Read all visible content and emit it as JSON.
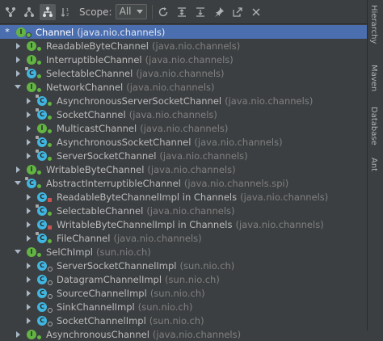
{
  "toolbar": {
    "scope_label": "Scope:",
    "scope_value": "All",
    "buttons": [
      {
        "name": "subtypes-hierarchy-icon"
      },
      {
        "name": "supertypes-hierarchy-icon"
      },
      {
        "name": "type-hierarchy-icon"
      },
      {
        "name": "sort-alphabetically-icon"
      }
    ]
  },
  "right_strip": {
    "tabs": [
      "Hierarchy",
      "Maven",
      "Database",
      "Ant"
    ]
  },
  "tree": [
    {
      "depth": 0,
      "arrow": "star",
      "kind": "i",
      "vis": "pub",
      "name": "Channel",
      "pkg": "(java.nio.channels)",
      "selected": true
    },
    {
      "depth": 1,
      "arrow": "right",
      "kind": "i",
      "vis": "pub",
      "name": "ReadableByteChannel",
      "pkg": "(java.nio.channels)"
    },
    {
      "depth": 1,
      "arrow": "right",
      "kind": "i",
      "vis": "pub",
      "name": "InterruptibleChannel",
      "pkg": "(java.nio.channels)"
    },
    {
      "depth": 1,
      "arrow": "right",
      "kind": "c",
      "vis": "pub",
      "abstract": true,
      "name": "SelectableChannel",
      "pkg": "(java.nio.channels)"
    },
    {
      "depth": 1,
      "arrow": "down",
      "kind": "i",
      "vis": "pub",
      "name": "NetworkChannel",
      "pkg": "(java.nio.channels)"
    },
    {
      "depth": 2,
      "arrow": "right",
      "kind": "c",
      "vis": "pub",
      "abstract": true,
      "name": "AsynchronousServerSocketChannel",
      "pkg": "(java.nio.channels)"
    },
    {
      "depth": 2,
      "arrow": "right",
      "kind": "c",
      "vis": "pub",
      "abstract": true,
      "name": "SocketChannel",
      "pkg": "(java.nio.channels)"
    },
    {
      "depth": 2,
      "arrow": "right",
      "kind": "i",
      "vis": "pub",
      "name": "MulticastChannel",
      "pkg": "(java.nio.channels)"
    },
    {
      "depth": 2,
      "arrow": "right",
      "kind": "c",
      "vis": "pub",
      "abstract": true,
      "name": "AsynchronousSocketChannel",
      "pkg": "(java.nio.channels)"
    },
    {
      "depth": 2,
      "arrow": "right",
      "kind": "c",
      "vis": "pub",
      "abstract": true,
      "name": "ServerSocketChannel",
      "pkg": "(java.nio.channels)"
    },
    {
      "depth": 1,
      "arrow": "right",
      "kind": "i",
      "vis": "pub",
      "name": "WritableByteChannel",
      "pkg": "(java.nio.channels)"
    },
    {
      "depth": 1,
      "arrow": "down",
      "kind": "c",
      "vis": "pub",
      "abstract": true,
      "name": "AbstractInterruptibleChannel",
      "pkg": "(java.nio.channels.spi)"
    },
    {
      "depth": 2,
      "arrow": "right",
      "kind": "c",
      "vis": "lock",
      "name": "ReadableByteChannelImpl in Channels",
      "pkg": "(java.nio.channels)"
    },
    {
      "depth": 2,
      "arrow": "right",
      "kind": "c",
      "vis": "pub",
      "abstract": true,
      "name": "SelectableChannel",
      "pkg": "(java.nio.channels)"
    },
    {
      "depth": 2,
      "arrow": "right",
      "kind": "c",
      "vis": "lock",
      "name": "WritableByteChannelImpl in Channels",
      "pkg": "(java.nio.channels)"
    },
    {
      "depth": 2,
      "arrow": "right",
      "kind": "c",
      "vis": "pub",
      "abstract": true,
      "name": "FileChannel",
      "pkg": "(java.nio.channels)"
    },
    {
      "depth": 1,
      "arrow": "down",
      "kind": "i",
      "vis": "pub",
      "name": "SelChImpl",
      "pkg": "(sun.nio.ch)"
    },
    {
      "depth": 2,
      "arrow": "right",
      "kind": "c",
      "vis": "pkg",
      "name": "ServerSocketChannelImpl",
      "pkg": "(sun.nio.ch)"
    },
    {
      "depth": 2,
      "arrow": "right",
      "kind": "c",
      "vis": "pkg",
      "name": "DatagramChannelImpl",
      "pkg": "(sun.nio.ch)"
    },
    {
      "depth": 2,
      "arrow": "right",
      "kind": "c",
      "vis": "pkg",
      "name": "SourceChannelImpl",
      "pkg": "(sun.nio.ch)"
    },
    {
      "depth": 2,
      "arrow": "right",
      "kind": "c",
      "vis": "pkg",
      "name": "SinkChannelImpl",
      "pkg": "(sun.nio.ch)"
    },
    {
      "depth": 2,
      "arrow": "right",
      "kind": "c",
      "vis": "pkg",
      "name": "SocketChannelImpl",
      "pkg": "(sun.nio.ch)"
    },
    {
      "depth": 1,
      "arrow": "right",
      "kind": "i",
      "vis": "pub",
      "name": "AsynchronousChannel",
      "pkg": "(java.nio.channels)"
    }
  ]
}
